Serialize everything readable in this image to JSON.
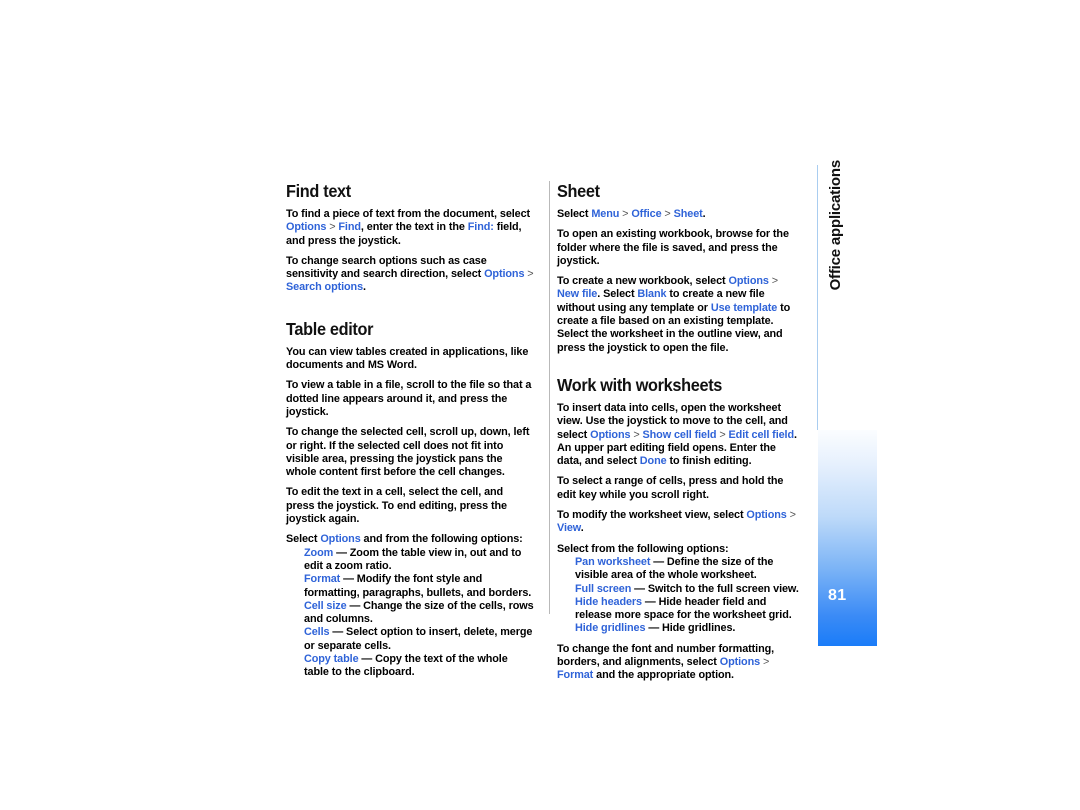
{
  "page": {
    "number": "81",
    "rail_label": "Office applications",
    "accent_blue": "#2f63d8",
    "tab_gradient_top": "#fbfdff",
    "tab_gradient_bottom": "#1a7cf8",
    "rail_line_color": "#a9cdf0",
    "divider_color": "#b9b9b9"
  },
  "left_column": {
    "find_text": {
      "heading": "Find text",
      "p1_a": "To find a piece of text from the document, select ",
      "p1_link1": "Options",
      "p1_sep1": " > ",
      "p1_link2": "Find",
      "p1_b": ", enter the text in the ",
      "p1_link3": "Find:",
      "p1_c": " field, and press the joystick.",
      "p2_a": "To change search options such as case sensitivity and search direction, select ",
      "p2_link1": "Options",
      "p2_sep1": " > ",
      "p2_link2": "Search options",
      "p2_b": "."
    },
    "table_editor": {
      "heading": "Table editor",
      "p1": "You can view tables created in applications, like documents and MS Word.",
      "p2": "To view a table in a file, scroll to the file so that a dotted line appears around it, and press the joystick.",
      "p3": "To change the selected cell, scroll up, down, left or right. If the selected cell does not fit into visible area, pressing the joystick pans the whole content first before the cell changes.",
      "p4": "To edit the text in a cell, select the cell, and press the joystick. To end editing, press the joystick again.",
      "p5_a": "Select ",
      "p5_link": "Options",
      "p5_b": " and from the following options:",
      "options": [
        {
          "name": "Zoom",
          "desc": " — Zoom the table view in, out and to edit a zoom ratio."
        },
        {
          "name": "Format",
          "desc": " — Modify the font style and formatting, paragraphs, bullets, and borders."
        },
        {
          "name": "Cell size",
          "desc": " — Change the size of the cells, rows and columns."
        },
        {
          "name": "Cells",
          "desc": " — Select option to insert, delete, merge or separate cells."
        },
        {
          "name": "Copy table",
          "desc": " — Copy the text of the whole table to the clipboard."
        }
      ]
    }
  },
  "right_column": {
    "sheet": {
      "heading": "Sheet",
      "p1_a": "Select ",
      "p1_link1": "Menu",
      "p1_sep1": " > ",
      "p1_link2": "Office",
      "p1_sep2": " > ",
      "p1_link3": "Sheet",
      "p1_b": ".",
      "p2": "To open an existing workbook, browse for the folder where the file is saved, and press the joystick.",
      "p3_a": "To create a new workbook, select ",
      "p3_link1": "Options",
      "p3_sep1": " > ",
      "p3_link2": "New file",
      "p3_b": ". Select ",
      "p3_link3": "Blank",
      "p3_c": " to create a new file without using any template or ",
      "p3_link4": "Use template",
      "p3_d": " to create a file based on an existing template. Select the worksheet in the outline view, and press the joystick to open the file."
    },
    "work_with_worksheets": {
      "heading": "Work with worksheets",
      "p1_a": "To insert data into cells, open the worksheet view. Use the joystick to move to the cell, and select ",
      "p1_link1": "Options",
      "p1_sep1": " > ",
      "p1_link2": "Show cell field",
      "p1_sep2": " > ",
      "p1_link3": "Edit cell field",
      "p1_b": ". An upper part editing field opens. Enter the data, and select ",
      "p1_link4": "Done",
      "p1_c": " to finish editing.",
      "p2": "To select a range of cells, press and hold the edit key while you scroll right.",
      "p3_a": "To modify the worksheet view, select ",
      "p3_link1": "Options",
      "p3_sep1": " > ",
      "p3_link2": "View",
      "p3_b": ".",
      "p4": "Select from the following options:",
      "options": [
        {
          "name": "Pan worksheet",
          "desc": " — Define the size of the visible area of the whole worksheet."
        },
        {
          "name": "Full screen",
          "desc": " — Switch to the full screen view."
        },
        {
          "name": "Hide headers",
          "desc": " — Hide header field and release more space for the worksheet grid."
        },
        {
          "name": "Hide gridlines",
          "desc": " — Hide gridlines."
        }
      ],
      "p5_a": "To change the font and number formatting, borders, and alignments, select ",
      "p5_link1": "Options",
      "p5_sep1": " > ",
      "p5_link2": "Format",
      "p5_b": " and the appropriate option."
    }
  }
}
